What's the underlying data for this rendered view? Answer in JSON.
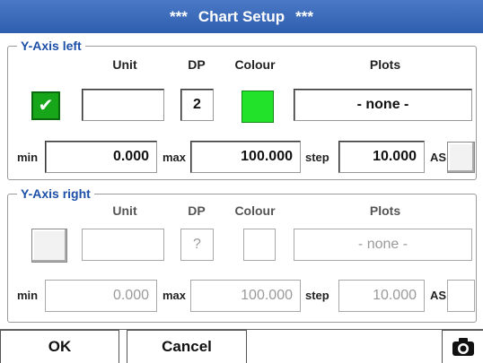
{
  "title": {
    "deco_left": "***",
    "text": "Chart Setup",
    "deco_right": "***"
  },
  "left": {
    "legend": "Y-Axis left",
    "headers": {
      "unit": "Unit",
      "dp": "DP",
      "colour": "Colour",
      "plots": "Plots"
    },
    "checked": true,
    "check_glyph": "✔",
    "unit_value": "",
    "dp_value": "2",
    "colour": "#22e22a",
    "plots_value": "- none -",
    "min_label": "min",
    "min_value": "0.000",
    "max_label": "max",
    "max_value": "100.000",
    "step_label": "step",
    "step_value": "10.000",
    "as_label": "AS"
  },
  "right": {
    "legend": "Y-Axis right",
    "headers": {
      "unit": "Unit",
      "dp": "DP",
      "colour": "Colour",
      "plots": "Plots"
    },
    "checked": false,
    "unit_value": "",
    "dp_value": "?",
    "plots_value": "- none -",
    "min_label": "min",
    "min_value": "0.000",
    "max_label": "max",
    "max_value": "100.000",
    "step_label": "step",
    "step_value": "10.000",
    "as_label": "AS"
  },
  "buttons": {
    "ok": "OK",
    "cancel": "Cancel",
    "camera_icon": "camera-icon"
  }
}
